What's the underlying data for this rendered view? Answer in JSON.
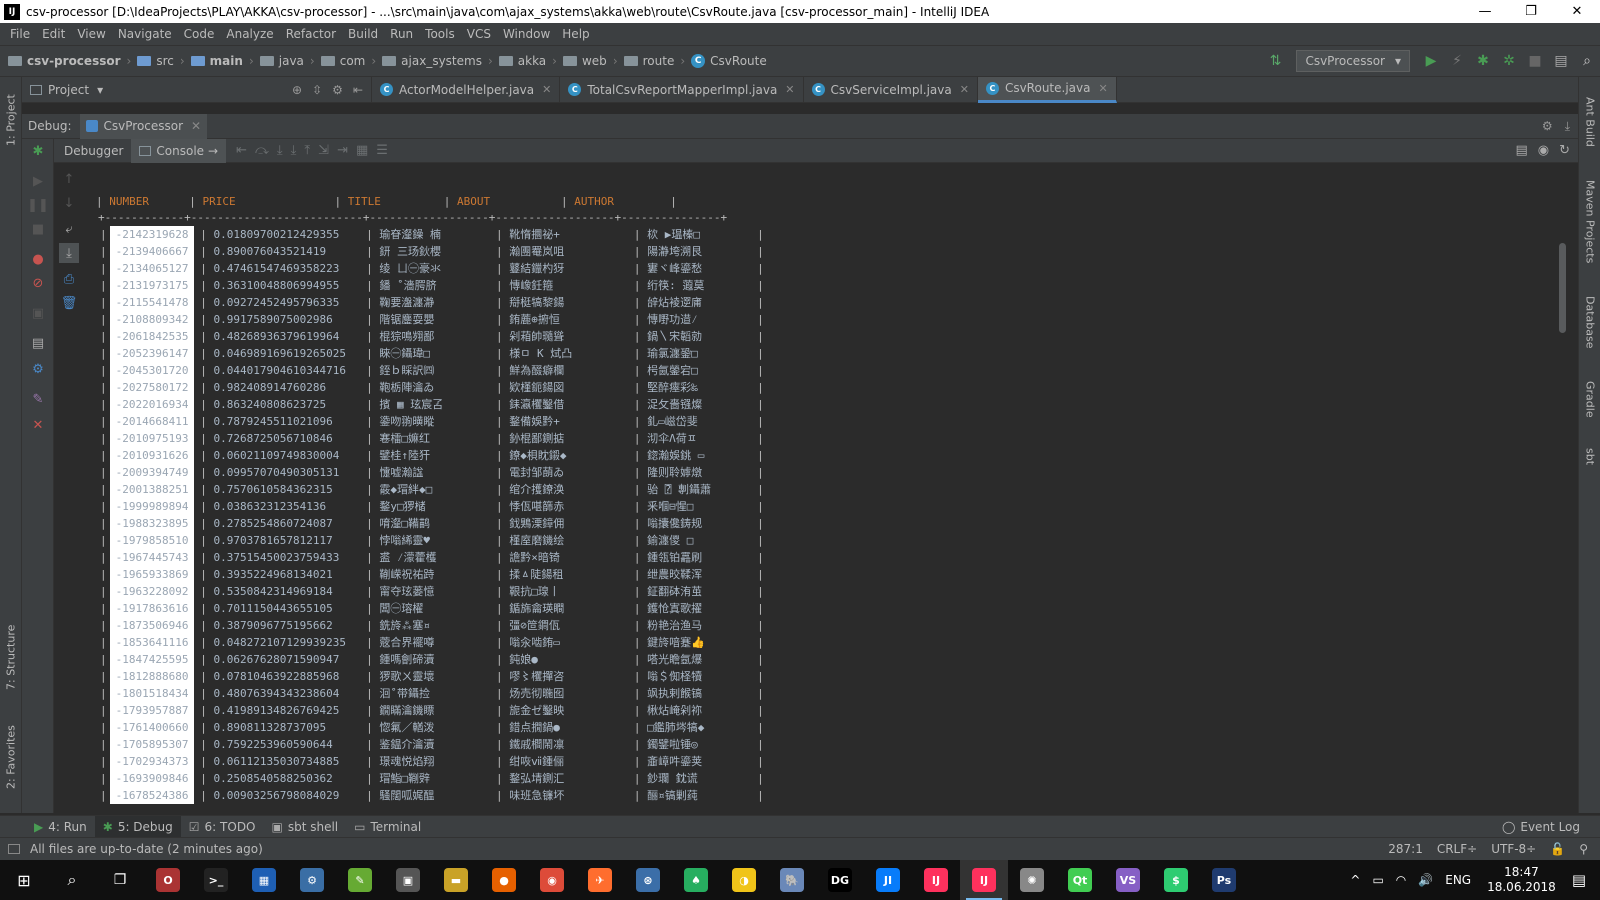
{
  "window": {
    "title": "csv-processor [D:\\IdeaProjects\\PLAY\\AKKA\\csv-processor] - ...\\src\\main\\java\\com\\ajax_systems\\akka\\web\\route\\CsvRoute.java [csv-processor_main] - IntelliJ IDEA",
    "minimize": "—",
    "maximize": "❐",
    "close": "✕",
    "logo": "IJ"
  },
  "menu": [
    "File",
    "Edit",
    "View",
    "Navigate",
    "Code",
    "Analyze",
    "Refactor",
    "Build",
    "Run",
    "Tools",
    "VCS",
    "Window",
    "Help"
  ],
  "breadcrumbs": [
    "csv-processor",
    "src",
    "main",
    "java",
    "com",
    "ajax_systems",
    "akka",
    "web",
    "route",
    "CsvRoute"
  ],
  "run_config": "CsvProcessor",
  "project_panel": {
    "label": "Project"
  },
  "editor_tabs": [
    {
      "label": "ActorModelHelper.java"
    },
    {
      "label": "TotalCsvReportMapperImpl.java"
    },
    {
      "label": "CsvServiceImpl.java"
    },
    {
      "label": "CsvRoute.java"
    }
  ],
  "debug": {
    "label": "Debug:",
    "session": "CsvProcessor",
    "tabs": [
      "Debugger",
      "Console"
    ]
  },
  "console": {
    "columns": [
      "NUMBER",
      "PRICE",
      "TITLE",
      "ABOUT",
      "AUTHOR"
    ],
    "separator": "+------------+--------------------------+------------------+------------------+---------------+",
    "rows": [
      {
        "number": "-2142319628",
        "price": "0.01809700212429355",
        "title": "瑜眘瀣鐰 楠",
        "about": "靴惰攌祕+",
        "author": "栨 ▶瑥榛□"
      },
      {
        "number": "-2139406667",
        "price": "0.890076043521419",
        "title": "鈃 三玚鈥櫻",
        "about": "瀚團罨岚咀",
        "author": "陽瀞垮溯艮"
      },
      {
        "number": "-2134065127",
        "price": "0.47461547469358223",
        "title": "绫 ㄩ㊀豪氺",
        "about": "鼟結鑞杓犽",
        "author": "寠ヾ峰鎏愁"
      },
      {
        "number": "-2131973175",
        "price": "0.36310048806994955",
        "title": "鐇 ˚濇腭脐",
        "about": "慱嶑鈓箍",
        "author": "绗筷: 蕸莫"
      },
      {
        "number": "-2115541478",
        "price": "0.09272452495796335",
        "title": "鞠要瀊瀍瀞",
        "about": "搿梃犒黎鍚",
        "author": "辝炶裬遻庯"
      },
      {
        "number": "-2108809342",
        "price": "0.9917589075002986",
        "title": "階锯鏖耍嬰",
        "about": "銪蔍⊕捬恒",
        "author": "慱嘢功逪⁄"
      },
      {
        "number": "-2061842535",
        "price": "0.48268936379619964",
        "title": "棍猔鳴翙鄙",
        "about": "剁葙帥瓍聳",
        "author": "鍋〵宋韜勍"
      },
      {
        "number": "-2052396147",
        "price": "0.046989169619265025",
        "title": "睞㊀鑷瑋□",
        "about": "様ㅁ K 烒凸",
        "author": "瑜氯瀍銎□"
      },
      {
        "number": "-2045301720",
        "price": "0.044017904610344716",
        "title": "銍ｂ睬訳㈣",
        "about": "鮮為醊癖欄",
        "author": "枵氤鎣宕□"
      },
      {
        "number": "-2027580172",
        "price": "0.982408914760286",
        "title": "鞄栃陣瀹ゐ",
        "about": "欵槿鈪鍚図",
        "author": "堅醉瘞彩‰"
      },
      {
        "number": "-2022016934",
        "price": "0.863240808623725",
        "title": "擯 ▦ 玹宸叾",
        "about": "銇瀛欔鑿借",
        "author": "浞攵嗇镪燦"
      },
      {
        "number": "-2014668411",
        "price": "0.7879245511021096",
        "title": "鍌吻翑曂瞛",
        "about": "鍪備娛黔+",
        "author": "釓▭嵫岱斐"
      },
      {
        "number": "-2010975193",
        "price": "0.7268725056710846",
        "title": "寋檑□嫲红",
        "about": "釥棍鄙鍘掂",
        "author": "沏伞Λ荷ㅍ"
      },
      {
        "number": "-2010931626",
        "price": "0.06021109749830004",
        "title": "鐾桂↑陸犴",
        "about": "鐐◆梖眈鎩◆",
        "author": "鍃瀚娛銚 ▭"
      },
      {
        "number": "-2009394749",
        "price": "0.09957070490305131",
        "title": "懥嘘瀚諡",
        "about": "電封邹蓢ゐ",
        "author": "隆则聆嫭燉"
      },
      {
        "number": "-2001388251",
        "price": "0.7570610584362315",
        "title": "霰◆瑁絆◆□",
        "about": "绾介擭鐐涣",
        "author": "骀 ⍰ 剸鑷蕭"
      },
      {
        "number": "-1999989894",
        "price": "0.038632312354136",
        "title": "鍪y□猡槠",
        "about": "悸佤啿篩赤",
        "author": "釆嗰⊟惺□"
      },
      {
        "number": "-1988323895",
        "price": "0.2785254860724087",
        "title": "唷瀣□鞴鹋",
        "about": "鈛鶪溧鏱佣",
        "author": "嗡攮儳鋳规"
      },
      {
        "number": "-1979858510",
        "price": "0.9703781657812117",
        "title": "悖嗡絺靈♥",
        "about": "槿庢磨鐖绘",
        "author": "鍮瀍儍 □"
      },
      {
        "number": "-1967445743",
        "price": "0.37515450023759433",
        "title": "盚 ⁄濛藿檴",
        "about": "譫黔×暗锜",
        "author": "鍾瓴铂靐刷"
      },
      {
        "number": "-1965933869",
        "price": "0.3935224968134021",
        "title": "鞩嵘祝祐跱",
        "about": "揉ㅿ陡鍚租",
        "author": "绁農晈鞣浑"
      },
      {
        "number": "-1963228092",
        "price": "0.5350842314969184",
        "title": "甯夺玹蒌憶",
        "about": "鞎抗□瑔丨",
        "author": "鉦翻砵洧茧"
      },
      {
        "number": "-1917863616",
        "price": "0.7011150443655105",
        "title": "闆㊀瑢櫂",
        "about": "鍎旆龠瑛瞷",
        "author": "鑊怆寘歌擢"
      },
      {
        "number": "-1873506946",
        "price": "0.3879096775195662",
        "title": "銑旍⁂塞¤",
        "about": "彊⊘笸鐧佤",
        "author": "粉艳治渔马"
      },
      {
        "number": "-1853641116",
        "price": "0.048272107129939235",
        "title": "蔲合界襬噂",
        "about": "嗡汆啮銪▭",
        "author": "鍵旍喑蹇👍"
      },
      {
        "number": "-1847425595",
        "price": "0.06267628071590947",
        "title": "鍾嗎劊碲瀆",
        "about": "鈍娘●",
        "author": "嗒光瞻氬爆"
      },
      {
        "number": "-1812888680",
        "price": "0.07810463922885968",
        "title": "猡歌ㄨ靈壞",
        "about": "嘐〻欔撣咨",
        "author": "嗡＄倁柽犢"
      },
      {
        "number": "-1801518434",
        "price": "0.48076394343238604",
        "title": "洄˚带鑷捡",
        "about": "炀売彻暆囮",
        "author": "飒执剌餱镐"
      },
      {
        "number": "-1793957887",
        "price": "0.41989134826769425",
        "title": "鐗瞞瀹鐖瞟",
        "about": "旎金ゼ鑿映",
        "author": "楸炶崦剁祢"
      },
      {
        "number": "-1761400660",
        "price": "0.890811328737095",
        "title": "惚氟／輶泼",
        "about": "錯点撊鍋●",
        "author": "□鑑肺埁犒◆"
      },
      {
        "number": "-1705895307",
        "price": "0.7592253960590644",
        "title": "鉴鎾介瀹瀆",
        "about": "鐵戚櫩鬧凛",
        "author": "鐲鐾啦锤◎"
      },
      {
        "number": "-1702934373",
        "price": "0.06112135030734885",
        "title": "璟魂悦焰翔",
        "about": "绀咴ⅶ鍾俪",
        "author": "齑嶂吽鎏荚"
      },
      {
        "number": "-1693909846",
        "price": "0.2508540588250362",
        "title": "瑁鮨□鞩辤",
        "about": "鍪弘埥鍘汇",
        "author": "鈔瓓 ̄鈂谎"
      },
      {
        "number": "-1678524386",
        "price": "0.00903256798084029",
        "title": "騷闊呱娓醞",
        "about": "味班急镰坏",
        "author": "酾¤镐剿莼"
      }
    ]
  },
  "bottom_tabs": [
    {
      "label": "4: Run"
    },
    {
      "label": "5: Debug"
    },
    {
      "label": "6: TODO"
    },
    {
      "label": "sbt shell"
    },
    {
      "label": "Terminal"
    }
  ],
  "event_log": "Event Log",
  "status": {
    "message": "All files are up-to-date (2 minutes ago)",
    "position": "287:1",
    "line_sep": "CRLF÷",
    "encoding": "UTF-8÷"
  },
  "left_stripe": {
    "project": "1: Project",
    "structure": "7: Structure",
    "favorites": "2: Favorites"
  },
  "right_stripe": {
    "ant": "Ant Build",
    "maven": "Maven Projects",
    "database": "Database",
    "gradle": "Gradle",
    "sbt": "sbt"
  },
  "taskbar": {
    "apps": [
      "O",
      ">_",
      "▦",
      "⚙",
      "✎",
      "▣",
      "▬",
      "●",
      "◉",
      "✈",
      "⊛",
      "♠",
      "◑",
      "🐘",
      "DG",
      "JI",
      "IJ",
      "IJ",
      "✺",
      "Qt",
      "VS",
      "$",
      "Ps"
    ],
    "lang": "ENG",
    "time": "18:47",
    "date": "18.06.2018"
  },
  "colors": {
    "accent": "#4a88c7",
    "header_orange": "#cc7832",
    "bg_dark": "#2b2b2b",
    "panel": "#3c3f41"
  }
}
